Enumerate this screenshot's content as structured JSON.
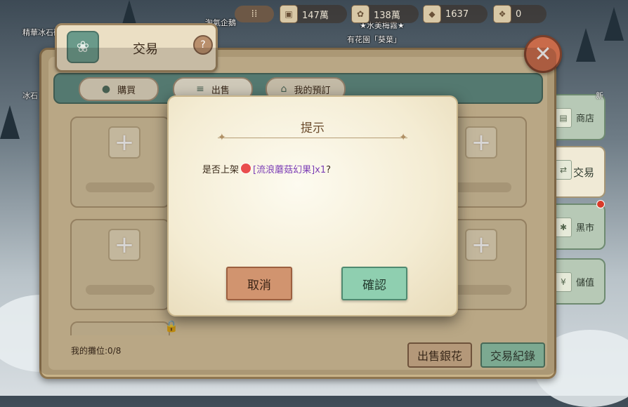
{
  "world": {
    "labels": [
      "精華冰石礦",
      "冰石",
      "淘氣企鵝",
      "★水美梅霧★",
      "有花園「葵葉」"
    ]
  },
  "resources": [
    {
      "icon": "menu-grid-icon",
      "value": ""
    },
    {
      "icon": "wood-crate-icon",
      "value": "147萬"
    },
    {
      "icon": "silver-flower-icon",
      "value": "138萬"
    },
    {
      "icon": "gem-crate-icon",
      "value": "1637"
    },
    {
      "icon": "gift-crate-icon",
      "value": "0"
    }
  ],
  "panel": {
    "title": "交易",
    "help_label": "?",
    "close_label": "✕",
    "tabs": [
      {
        "label": "購買",
        "icon": "bag-icon"
      },
      {
        "label": "出售",
        "icon": "coins-icon"
      },
      {
        "label": "我的預訂",
        "icon": "stall-icon"
      }
    ],
    "stall_count": "我的攤位:0/8",
    "buttons": {
      "sell_silver": "出售銀花",
      "trade_log": "交易紀錄"
    }
  },
  "side_tabs": [
    {
      "label": "商店",
      "icon": "shop-icon"
    },
    {
      "label": "交易",
      "icon": "trade-icon"
    },
    {
      "label": "黑市",
      "icon": "black-market-icon"
    },
    {
      "label": "儲值",
      "icon": "yen-icon"
    }
  ],
  "new_mark": "新",
  "dialog": {
    "title": "提示",
    "message_prefix": "是否上架",
    "item_name": "[流浪蘑菇幻果]x1",
    "message_suffix": "?",
    "cancel": "取消",
    "confirm": "確認"
  },
  "colors": {
    "item_name": "#7c3fb6",
    "confirm_button": "#8fcfb0",
    "cancel_button": "#d1946f",
    "tab_bar": "#5f8e84",
    "notification_dot": "#d83a2a"
  }
}
